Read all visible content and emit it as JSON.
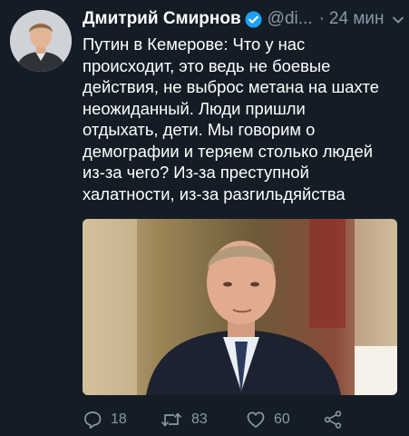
{
  "author": {
    "name": "Дмитрий Смирнов",
    "handle": "@di...",
    "separator": "·",
    "time": "24 мин"
  },
  "tweet": {
    "text": "Путин в Кемерове: Что у нас\nпроисходит, это ведь не боевые\nдействия, не выброс метана на шахте\nнеожиданный. Люди пришли\nотдыхать, дети. Мы говорим о\nдемографии и теряем столько людей\nиз-за чего? Из-за преступной\nхалатности, из-за разгильдяйства"
  },
  "actions": {
    "replies": "18",
    "retweets": "83",
    "likes": "60"
  },
  "icons": {
    "verified": "verified-badge-icon",
    "menu": "chevron-down-icon",
    "reply": "reply-icon",
    "retweet": "retweet-icon",
    "like": "heart-icon",
    "share": "share-icon"
  },
  "colors": {
    "background": "#141d26",
    "text": "#ffffff",
    "secondary": "#8899a6",
    "verified": "#1da1f2"
  }
}
